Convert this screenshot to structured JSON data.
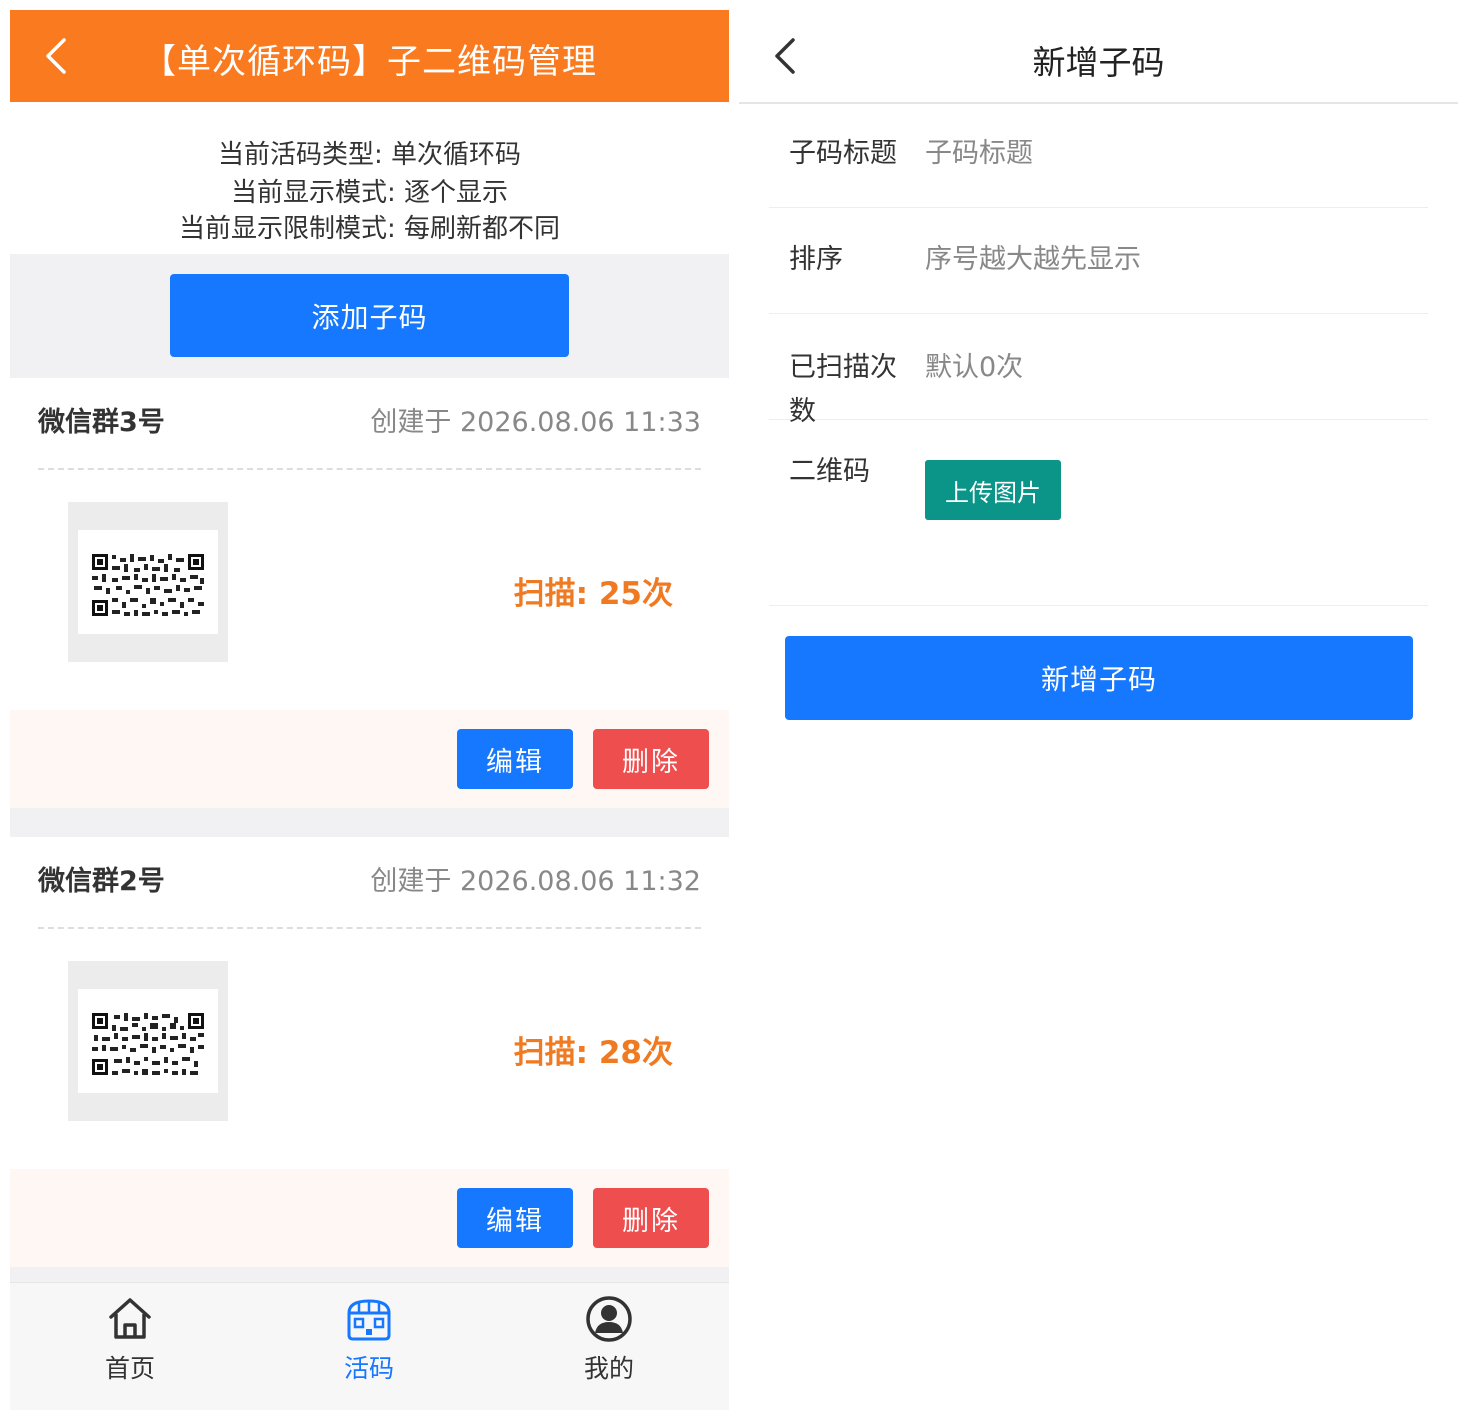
{
  "left": {
    "header": {
      "title": "【单次循环码】子二维码管理"
    },
    "info": [
      "当前活码类型:  单次循环码",
      "当前显示模式:   逐个显示",
      "当前显示限制模式:  每刷新都不同"
    ],
    "add_button": "添加子码",
    "cards": [
      {
        "name": "微信群3号",
        "created": "创建于 2026.08.06 11:33",
        "scan": "扫描:  25次",
        "edit": "编辑",
        "delete": "删除"
      },
      {
        "name": "微信群2号",
        "created": "创建于 2026.08.06 11:32",
        "scan": "扫描:  28次",
        "edit": "编辑",
        "delete": "删除"
      }
    ],
    "tabbar": [
      {
        "label": "首页",
        "icon": "home-icon"
      },
      {
        "label": "活码",
        "icon": "qrcode-box-icon",
        "active": true
      },
      {
        "label": "我的",
        "icon": "user-icon"
      }
    ],
    "colors": {
      "header": "#fa7a20",
      "primary": "#1677ff",
      "danger": "#ee4e4e",
      "scan": "#f07a22"
    }
  },
  "right": {
    "header": {
      "title": "新增子码"
    },
    "fields": {
      "title": {
        "label": "子码标题",
        "placeholder": "子码标题"
      },
      "order": {
        "label": "排序",
        "placeholder": "序号越大越先显示"
      },
      "scans": {
        "label": "已扫描次数",
        "placeholder": "默认0次"
      },
      "qrcode": {
        "label": "二维码",
        "upload": "上传图片"
      }
    },
    "submit": "新增子码",
    "colors": {
      "upload": "#0b9488",
      "primary": "#1677ff"
    }
  }
}
